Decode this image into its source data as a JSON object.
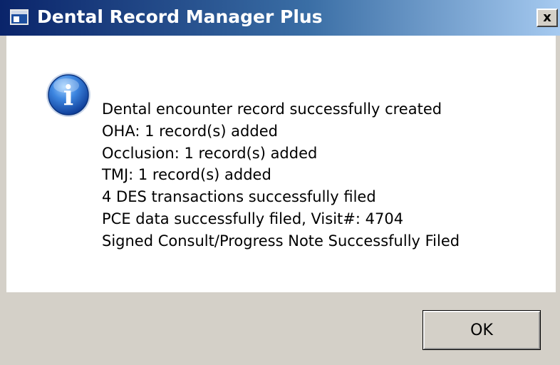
{
  "window": {
    "title": "Dental Record Manager Plus",
    "close_label": "x",
    "title_icon": "application-window-icon",
    "close_icon": "close-icon"
  },
  "dialog": {
    "icon": "information-icon",
    "icon_glyph": "i",
    "message_lines": [
      "Dental encounter record successfully created",
      "OHA: 1 record(s) added",
      "Occlusion: 1 record(s) added",
      "TMJ: 1 record(s) added",
      "4 DES transactions successfully filed",
      "PCE data successfully filed, Visit#: 4704",
      "Signed Consult/Progress Note Successfully Filed"
    ],
    "ok_label": "OK"
  },
  "colors": {
    "titlebar_start": "#0a246a",
    "titlebar_end": "#a6caf0",
    "dialog_face": "#d4d0c8",
    "content_bg": "#ffffff",
    "info_icon_blue": "#2a6fd0"
  }
}
